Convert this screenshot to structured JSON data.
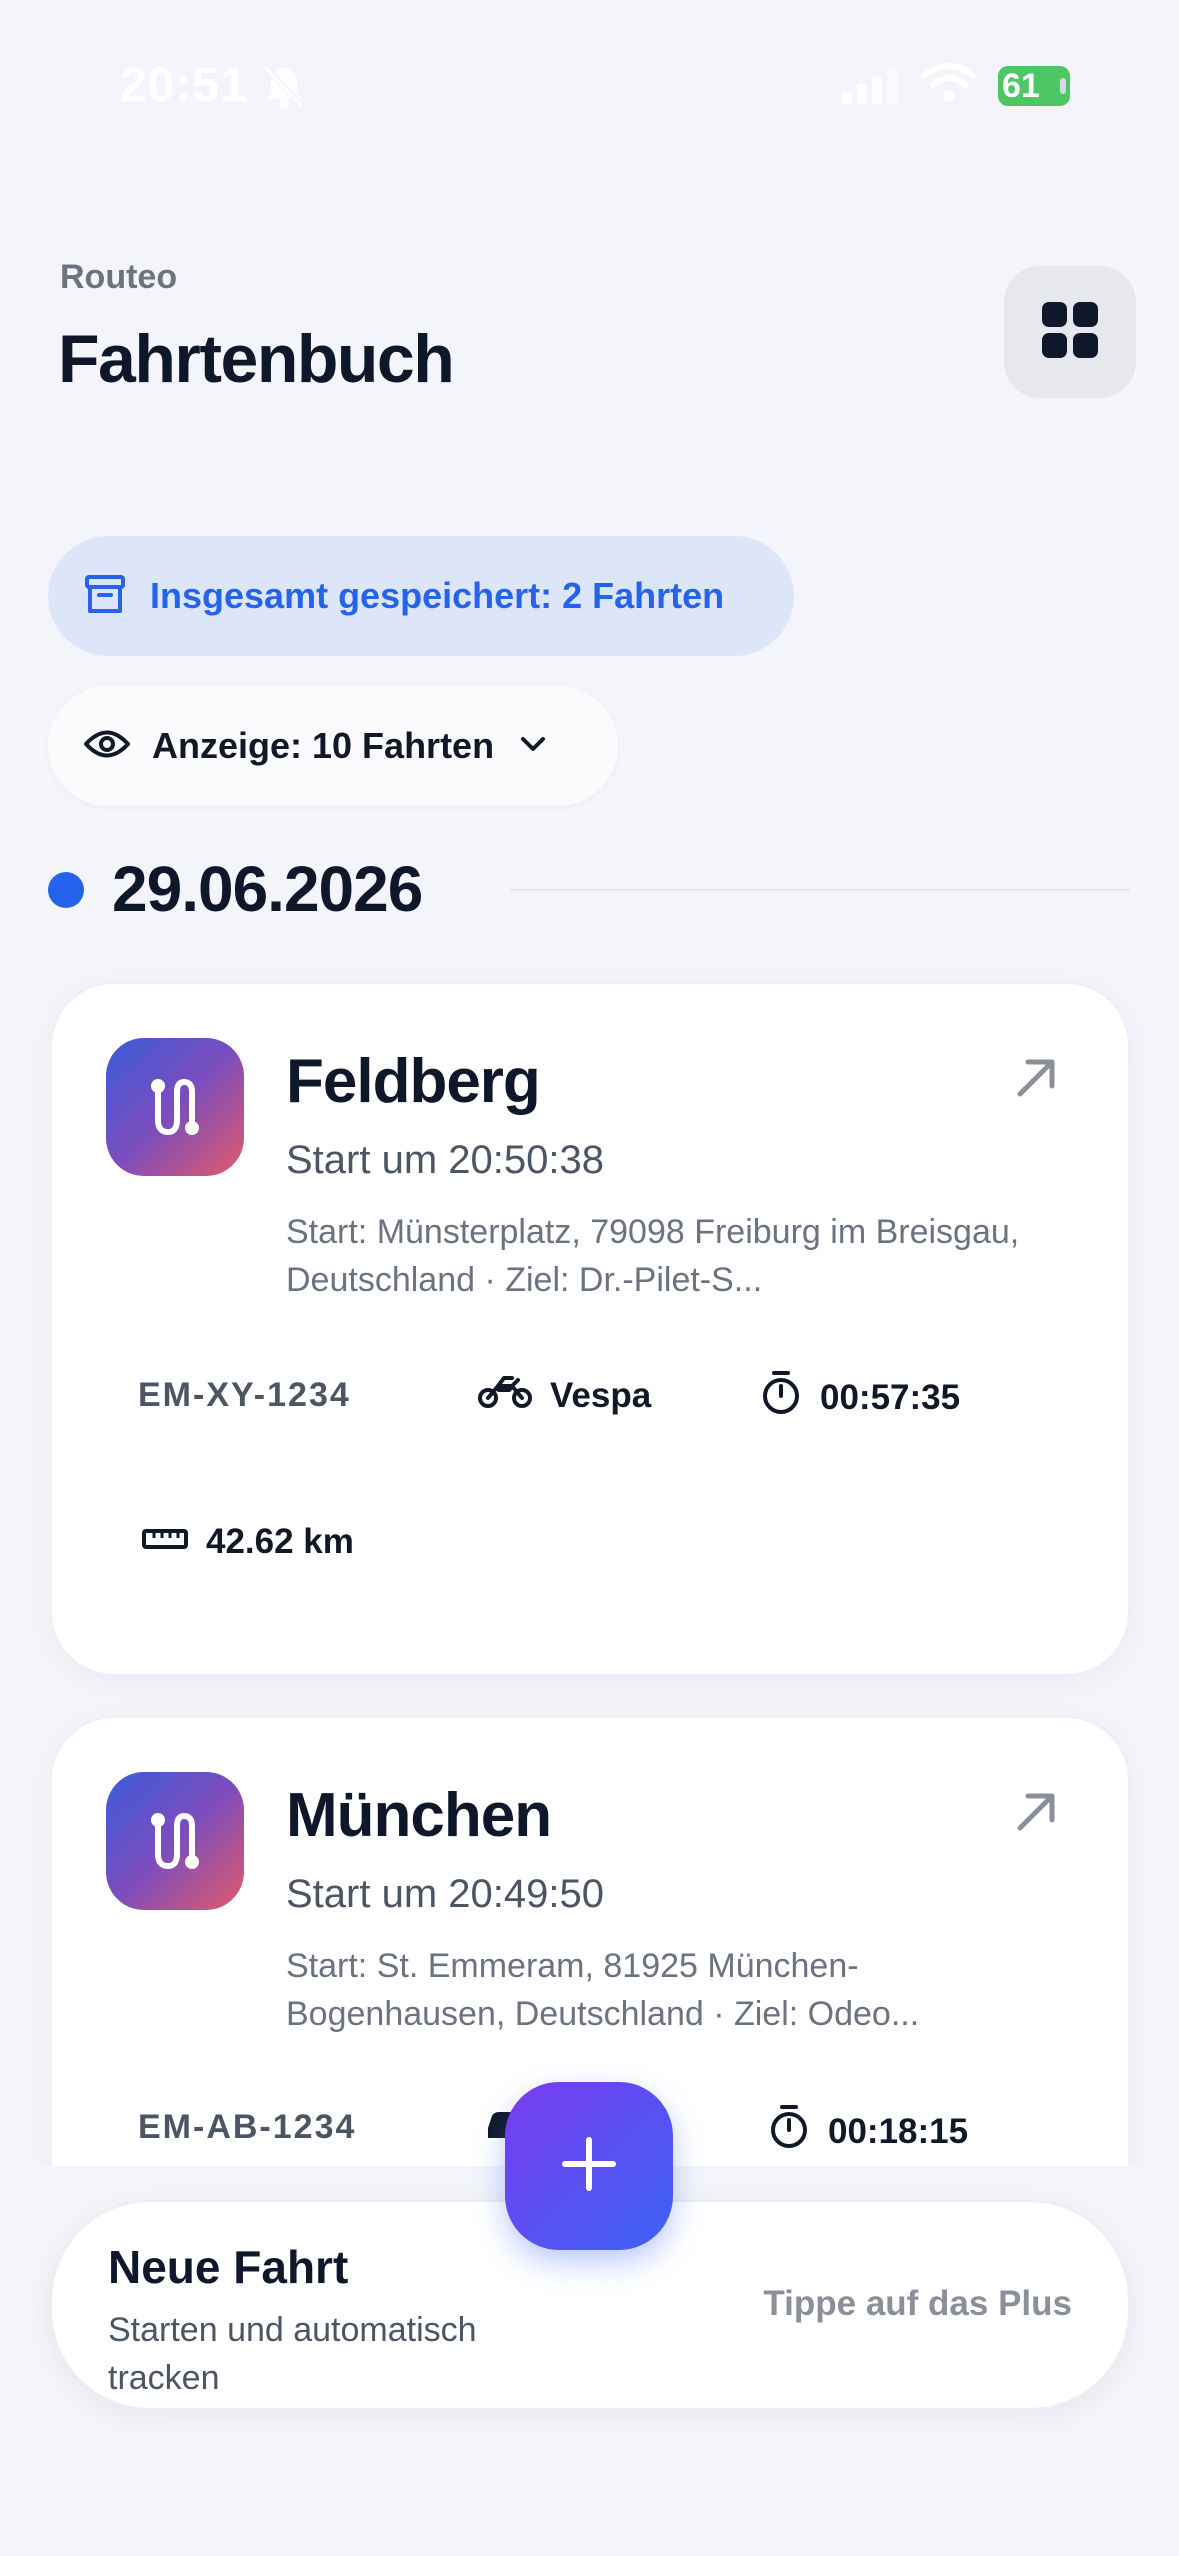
{
  "status_bar": {
    "time": "20:51",
    "battery": "61"
  },
  "header": {
    "app_name": "Routeo",
    "title": "Fahrtenbuch",
    "grid_icon": "grid-icon"
  },
  "summary": {
    "total_label": "Insgesamt gespeichert: 2 Fahrten",
    "view_label": "Anzeige: 10 Fahrten"
  },
  "date_group": {
    "date": "29.06.2026",
    "accent": "#2563eb"
  },
  "trips": [
    {
      "title": "Feldberg",
      "start_time": "Start um 20:50:38",
      "route": "Start: Münsterplatz, 79098 Freiburg im Breisgau, Deutschland · Ziel: Dr.-Pilet-S...",
      "plate": "EM-XY-1234",
      "vehicle": "Vespa",
      "vehicle_icon": "motorcycle-icon",
      "duration": "00:57:35",
      "distance": "42.62 km"
    },
    {
      "title": "München",
      "start_time": "Start um 20:49:50",
      "route": "Start: St. Emmeram, 81925 München-Bogenhausen, Deutschland · Ziel: Odeo...",
      "plate": "EM-AB-1234",
      "vehicle_icon": "car-icon",
      "duration": "00:18:15"
    }
  ],
  "new_trip": {
    "title": "Neue Fahrt",
    "subtitle": "Starten und automatisch tracken",
    "hint": "Tippe auf das Plus"
  }
}
